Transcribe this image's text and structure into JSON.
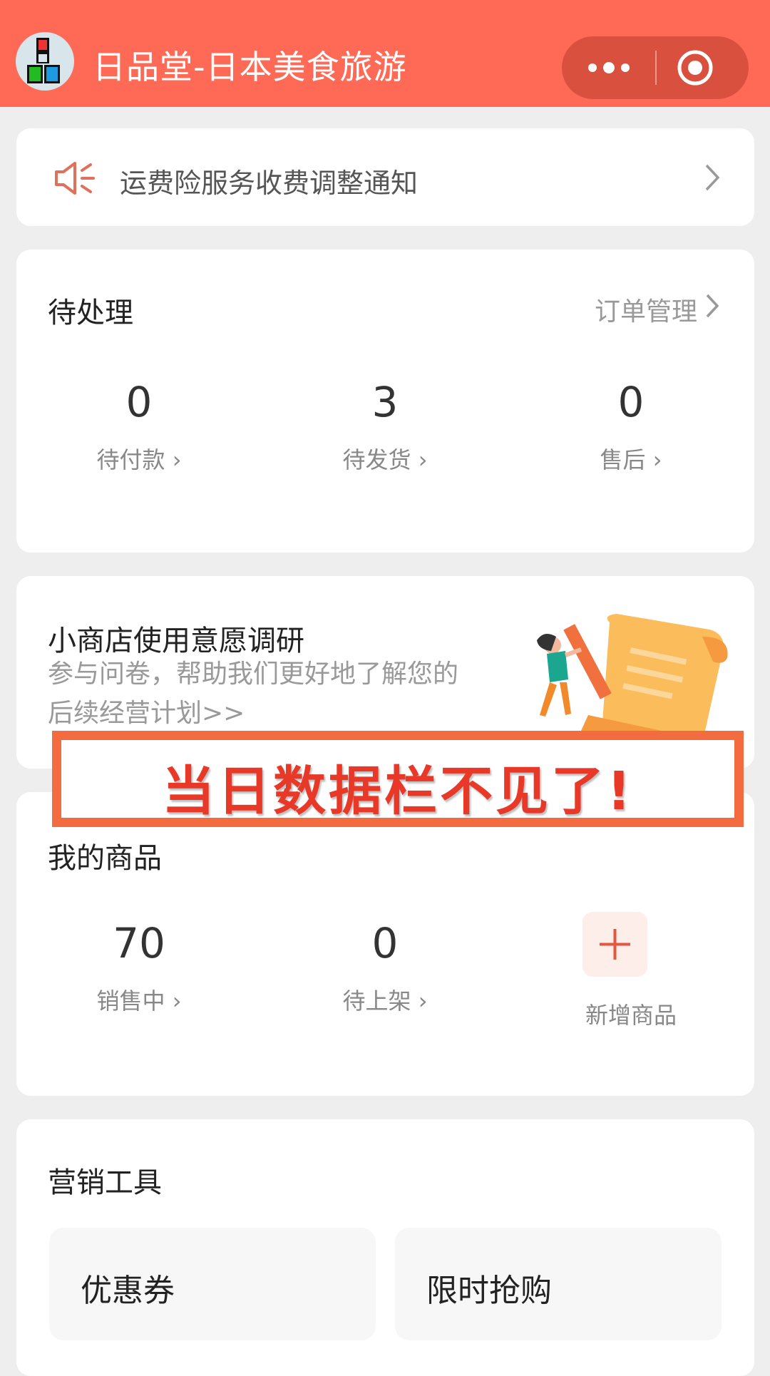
{
  "header": {
    "title": "日品堂-日本美食旅游",
    "bg_color": "#fe6a55"
  },
  "notice": {
    "text": "运费险服务收费调整通知"
  },
  "pending": {
    "title": "待处理",
    "link": "订单管理",
    "stats": [
      {
        "value": "0",
        "label": "待付款"
      },
      {
        "value": "3",
        "label": "待发货"
      },
      {
        "value": "0",
        "label": "售后"
      }
    ]
  },
  "survey": {
    "title": "小商店使用意愿调研",
    "subtitle": "参与问卷，帮助我们更好地了解您的后续经营计划>>"
  },
  "overlay_banner": {
    "text": "当日数据栏不见了!"
  },
  "products": {
    "title": "我的商品",
    "stats": [
      {
        "value": "70",
        "label": "销售中"
      },
      {
        "value": "0",
        "label": "待上架"
      }
    ],
    "add_label": "新增商品"
  },
  "marketing": {
    "title": "营销工具",
    "tools": [
      "优惠券",
      "限时抢购"
    ]
  },
  "colors": {
    "accent": "#fe6a55",
    "banner_border": "#f26c3f",
    "banner_text": "#e83828"
  }
}
